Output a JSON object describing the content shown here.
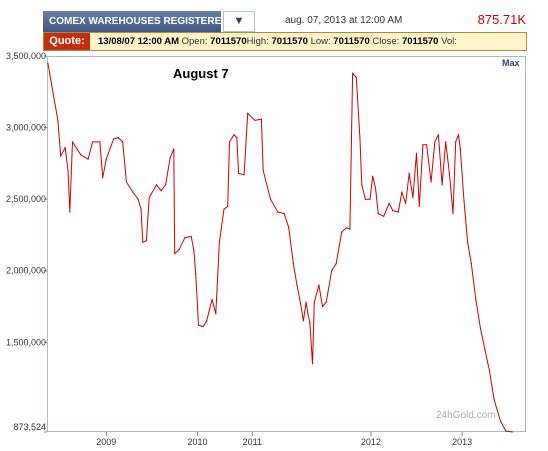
{
  "header": {
    "title": "COMEX WAREHOUSES REGISTERED S",
    "menu_glyph": "▼",
    "datetime": "aug. 07, 2013 at 12:00 AM",
    "price": "875.71K"
  },
  "quote": {
    "label": "Quote:",
    "date": "13/08/07",
    "time": "12:00 AM",
    "open_label": "Open:",
    "open": "7011570",
    "high_label": "High:",
    "high": "7011570",
    "low_label": "Low:",
    "low": "7011570",
    "close_label": "Close:",
    "close": "7011570",
    "vol_label": "Vol:",
    "vol": ""
  },
  "range_link": "Max",
  "watermark": "24hGold.com",
  "colors": {
    "line": "#cc0000",
    "accent": "#3e5683",
    "quote_bg": "#fdf3c8"
  },
  "chart_data": {
    "type": "line",
    "annotation": "August 7",
    "title": "",
    "xlabel": "",
    "ylabel": "",
    "grid": false,
    "xlim": [
      2008.35,
      2013.6
    ],
    "ylim": [
      873524,
      3500000
    ],
    "y_ticks": [
      {
        "value": 3500000,
        "label": "3,500,000"
      },
      {
        "value": 3000000,
        "label": "3,000,000"
      },
      {
        "value": 2500000,
        "label": "2,500,000"
      },
      {
        "value": 2000000,
        "label": "2,000,000"
      },
      {
        "value": 1500000,
        "label": "1,500,000"
      },
      {
        "value": 873524,
        "label": "873,524"
      }
    ],
    "x_ticks": [
      {
        "value": 2009.0,
        "label": "2009"
      },
      {
        "value": 2010.0,
        "label": "2010"
      },
      {
        "value": 2010.6,
        "label": "2011"
      },
      {
        "value": 2011.9,
        "label": "2012"
      },
      {
        "value": 2012.9,
        "label": "2013"
      }
    ],
    "series": [
      {
        "values": [
          [
            2008.36,
            3450000
          ],
          [
            2008.4,
            3300000
          ],
          [
            2008.47,
            3050000
          ],
          [
            2008.5,
            2800000
          ],
          [
            2008.55,
            2860000
          ],
          [
            2008.58,
            2700000
          ],
          [
            2008.6,
            2410000
          ],
          [
            2008.63,
            2900000
          ],
          [
            2008.72,
            2810000
          ],
          [
            2008.8,
            2780000
          ],
          [
            2008.85,
            2900000
          ],
          [
            2008.93,
            2900000
          ],
          [
            2008.96,
            2650000
          ],
          [
            2009.0,
            2780000
          ],
          [
            2009.08,
            2920000
          ],
          [
            2009.13,
            2930000
          ],
          [
            2009.18,
            2900000
          ],
          [
            2009.22,
            2620000
          ],
          [
            2009.29,
            2550000
          ],
          [
            2009.35,
            2500000
          ],
          [
            2009.38,
            2430000
          ],
          [
            2009.4,
            2200000
          ],
          [
            2009.44,
            2210000
          ],
          [
            2009.47,
            2510000
          ],
          [
            2009.55,
            2600000
          ],
          [
            2009.6,
            2560000
          ],
          [
            2009.65,
            2600000
          ],
          [
            2009.7,
            2790000
          ],
          [
            2009.74,
            2850000
          ],
          [
            2009.75,
            2120000
          ],
          [
            2009.8,
            2150000
          ],
          [
            2009.86,
            2230000
          ],
          [
            2009.93,
            2240000
          ],
          [
            2009.96,
            2140000
          ],
          [
            2009.98,
            1980000
          ],
          [
            2010.01,
            1620000
          ],
          [
            2010.06,
            1610000
          ],
          [
            2010.1,
            1650000
          ],
          [
            2010.16,
            1800000
          ],
          [
            2010.2,
            1700000
          ],
          [
            2010.24,
            2200000
          ],
          [
            2010.29,
            2430000
          ],
          [
            2010.33,
            2450000
          ],
          [
            2010.35,
            2900000
          ],
          [
            2010.4,
            2950000
          ],
          [
            2010.43,
            2930000
          ],
          [
            2010.45,
            2680000
          ],
          [
            2010.51,
            2670000
          ],
          [
            2010.55,
            3100000
          ],
          [
            2010.63,
            3050000
          ],
          [
            2010.7,
            3060000
          ],
          [
            2010.72,
            2700000
          ],
          [
            2010.8,
            2500000
          ],
          [
            2010.88,
            2410000
          ],
          [
            2010.95,
            2400000
          ],
          [
            2011.0,
            2300000
          ],
          [
            2011.05,
            2050000
          ],
          [
            2011.09,
            1900000
          ],
          [
            2011.13,
            1770000
          ],
          [
            2011.16,
            1650000
          ],
          [
            2011.19,
            1780000
          ],
          [
            2011.21,
            1700000
          ],
          [
            2011.23,
            1640000
          ],
          [
            2011.26,
            1350000
          ],
          [
            2011.28,
            1780000
          ],
          [
            2011.33,
            1900000
          ],
          [
            2011.37,
            1750000
          ],
          [
            2011.41,
            1780000
          ],
          [
            2011.47,
            2000000
          ],
          [
            2011.52,
            2050000
          ],
          [
            2011.58,
            2270000
          ],
          [
            2011.63,
            2300000
          ],
          [
            2011.67,
            2290000
          ],
          [
            2011.7,
            3380000
          ],
          [
            2011.74,
            3350000
          ],
          [
            2011.78,
            2930000
          ],
          [
            2011.8,
            2600000
          ],
          [
            2011.84,
            2500000
          ],
          [
            2011.89,
            2500000
          ],
          [
            2011.92,
            2660000
          ],
          [
            2011.95,
            2580000
          ],
          [
            2011.98,
            2400000
          ],
          [
            2012.04,
            2380000
          ],
          [
            2012.1,
            2470000
          ],
          [
            2012.14,
            2420000
          ],
          [
            2012.2,
            2410000
          ],
          [
            2012.24,
            2550000
          ],
          [
            2012.28,
            2470000
          ],
          [
            2012.32,
            2680000
          ],
          [
            2012.36,
            2510000
          ],
          [
            2012.4,
            2820000
          ],
          [
            2012.43,
            2450000
          ],
          [
            2012.47,
            2880000
          ],
          [
            2012.51,
            2880000
          ],
          [
            2012.56,
            2620000
          ],
          [
            2012.6,
            2900000
          ],
          [
            2012.64,
            2950000
          ],
          [
            2012.68,
            2600000
          ],
          [
            2012.72,
            2900000
          ],
          [
            2012.76,
            2680000
          ],
          [
            2012.8,
            2400000
          ],
          [
            2012.83,
            2900000
          ],
          [
            2012.86,
            2950000
          ],
          [
            2012.88,
            2850000
          ],
          [
            2012.92,
            2490000
          ],
          [
            2012.96,
            2200000
          ],
          [
            2013.0,
            2050000
          ],
          [
            2013.05,
            1800000
          ],
          [
            2013.1,
            1600000
          ],
          [
            2013.15,
            1450000
          ],
          [
            2013.2,
            1300000
          ],
          [
            2013.25,
            1100000
          ],
          [
            2013.32,
            950000
          ],
          [
            2013.38,
            880000
          ],
          [
            2013.45,
            873524
          ]
        ]
      }
    ]
  }
}
